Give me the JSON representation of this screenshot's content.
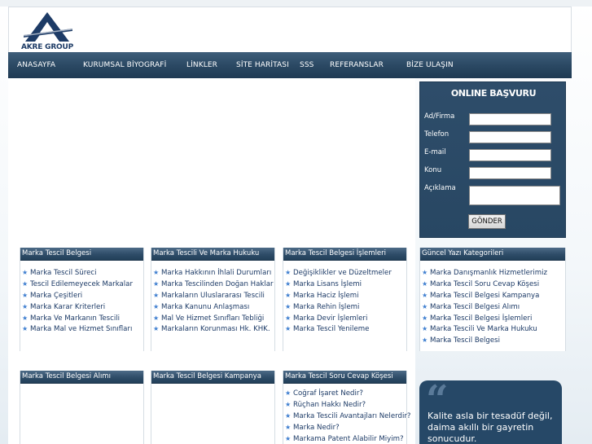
{
  "brand": {
    "logo_text": "AKRE GROUP",
    "primary_color": "#1d3b66"
  },
  "nav": {
    "items": [
      {
        "label": "ANASAYFA"
      },
      {
        "label": "KURUMSAL BİYOGRAFİ"
      },
      {
        "label": "LİNKLER"
      },
      {
        "label": "SİTE HARİTASI"
      },
      {
        "label": "SSS"
      },
      {
        "label": "REFERANSLAR"
      },
      {
        "label": "BİZE ULAŞIN"
      }
    ]
  },
  "form": {
    "title": "ONLINE BAŞVURU",
    "fields": [
      {
        "label": "Ad/Firma",
        "value": ""
      },
      {
        "label": "Telefon",
        "value": ""
      },
      {
        "label": "E-mail",
        "value": ""
      },
      {
        "label": "Konu",
        "value": ""
      },
      {
        "label": "Açıklama",
        "value": ""
      }
    ],
    "submit_label": "GÖNDER"
  },
  "boxes": [
    {
      "title": "Marka Tescil Belgesi",
      "items": [
        "Marka Tescil Süreci",
        "Tescil Edilemeyecek Markalar",
        "Marka Çeşitleri",
        "Marka Karar Kriterleri",
        "Marka Ve Markanın Tescili",
        "Marka Mal ve Hizmet Sınıfları"
      ]
    },
    {
      "title": "Marka Tescili Ve Marka Hukuku",
      "items": [
        "Marka Hakkının İhlali Durumları",
        "Marka Tescilinden Doğan Haklar",
        "Markaların Uluslararası Tescili",
        "Marka Kanunu Anlaşması",
        "Mal Ve Hizmet Sınıfları Tebliği",
        "Markaların Korunması Hk. KHK."
      ]
    },
    {
      "title": "Marka Tescil Belgesi İşlemleri",
      "items": [
        "Değişiklikler ve Düzeltmeler",
        "Marka Lisans İşlemi",
        "Marka Haciz İşlemi",
        "Marka Rehin İşlemi",
        "Marka Devir İşlemleri",
        "Marka Tescil Yenileme"
      ]
    },
    {
      "title": "Güncel Yazı Kategorileri",
      "items": [
        "Marka Danışmanlık Hizmetlerimiz",
        "Marka Tescil Soru Cevap Köşesi",
        "Marka Tescil Belgesi Kampanya",
        "Marka Tescil Belgesi Alımı",
        "Marka Tescil Belgesi İşlemleri",
        "Marka Tescili Ve Marka Hukuku",
        "Marka Tescil Belgesi"
      ]
    },
    {
      "title": "Marka Tescil Belgesi Alımı",
      "items": []
    },
    {
      "title": "Marka Tescil Belgesi Kampanya",
      "items": []
    },
    {
      "title": "Marka Tescil Soru Cevap Köşesi",
      "items": [
        "Coğraf İşaret Nedir?",
        "Rüçhan Hakkı Nedir?",
        "Marka Tescili Avantajları Nelerdir?",
        "Marka Nedir?",
        "Markama Patent Alabilir Miyim?"
      ]
    }
  ],
  "quote": {
    "text": "Kalite asla bir tesadüf değil, daima akıllı bir gayretin sonucudur."
  }
}
